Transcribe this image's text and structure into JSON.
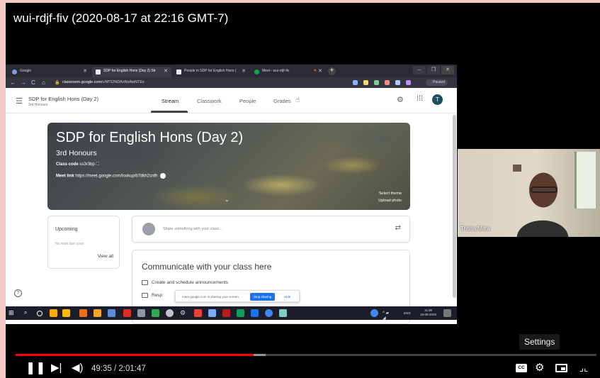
{
  "video": {
    "title": "wui-rdjf-fiv (2020-08-17 at 22:16 GMT-7)"
  },
  "browser": {
    "tabs": [
      {
        "label": "Google",
        "active": false
      },
      {
        "label": "SDP for English Hons (Day 2) Str",
        "active": true
      },
      {
        "label": "People in SDP for English Hons (",
        "active": false
      },
      {
        "label": "Meet - wui-rdjf-fiv",
        "active": false
      }
    ],
    "url_domain": "classroom.google.com",
    "url_path": "/c/MTI2NDAzNzAwNTEx",
    "profile_status": "Paused"
  },
  "classroom": {
    "class_name": "SDP for English Hons (Day 2)",
    "section": "3rd Honours",
    "tabs": [
      "Stream",
      "Classwork",
      "People",
      "Grades"
    ],
    "active_tab": "Stream",
    "avatar_initial": "T",
    "banner": {
      "title": "SDP for English Hons (Day 2)",
      "section": "3rd Honours",
      "class_code_label": "Class code",
      "class_code": "ss3r3bp",
      "meet_link_label": "Meet link",
      "meet_link": "https://meet.google.com/lookup/b7dkh2cnfh",
      "select_theme": "Select theme",
      "upload_photo": "Upload photo"
    },
    "upcoming": {
      "title": "Upcoming",
      "empty_text": "No work due soon",
      "view_all": "View all"
    },
    "share_placeholder": "Share something with your class...",
    "communicate": {
      "title": "Communicate with your class here",
      "items": [
        "Create and schedule announcements",
        "Resp"
      ]
    }
  },
  "screen_share_bar": {
    "text": "meet.google.com is sharing your screen.",
    "stop_label": "Stop sharing",
    "hide_label": "Hide"
  },
  "taskbar": {
    "language": "ENG",
    "time": "11:38",
    "date": "18-08-2020"
  },
  "webcam": {
    "participant_name": "Trisha Mitra"
  },
  "player": {
    "current_time": "49:35",
    "duration": "2:01:47",
    "played_fraction": 0.41,
    "loaded_fraction": 0.43,
    "settings_tooltip": "Settings",
    "cc_label": "CC"
  },
  "colors": {
    "page_background": "#f4c9c6",
    "progress_red": "#ff0000",
    "stop_sharing_blue": "#1a73e8"
  }
}
